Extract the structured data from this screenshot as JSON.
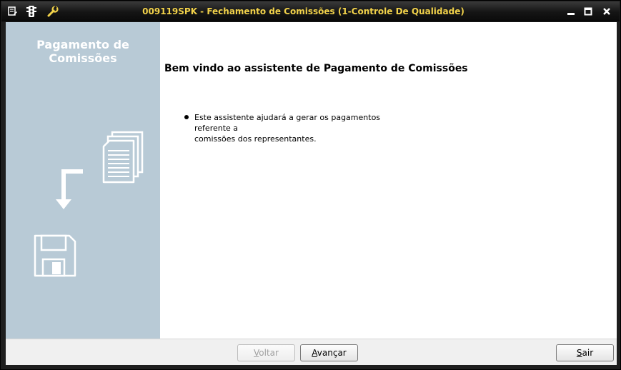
{
  "window": {
    "title": "009119SPK - Fechamento de Comissões (1-Controle De Qualidade)",
    "title_color": "#f2d24a",
    "icons": [
      "edit-icon",
      "traffic-light-icon",
      "wrench-icon"
    ],
    "controls": [
      "minimize-icon",
      "maximize-icon",
      "close-icon"
    ]
  },
  "sidebar": {
    "title_line1": "Pagamento de",
    "title_line2": "Comissões",
    "background": "#b8cad6",
    "icons": [
      "documents-icon",
      "arrow-down-icon",
      "floppy-disk-icon"
    ]
  },
  "main": {
    "heading": "Bem vindo ao assistente de Pagamento de Comissões",
    "bullet_line1": "Este assistente ajudará a gerar os pagamentos referente a",
    "bullet_line2": "comissões dos representantes."
  },
  "footer": {
    "back": {
      "accel": "V",
      "rest": "oltar",
      "enabled": false
    },
    "next": {
      "accel": "A",
      "rest": "vançar",
      "enabled": true
    },
    "exit": {
      "accel": "S",
      "rest": "air",
      "enabled": true
    }
  }
}
